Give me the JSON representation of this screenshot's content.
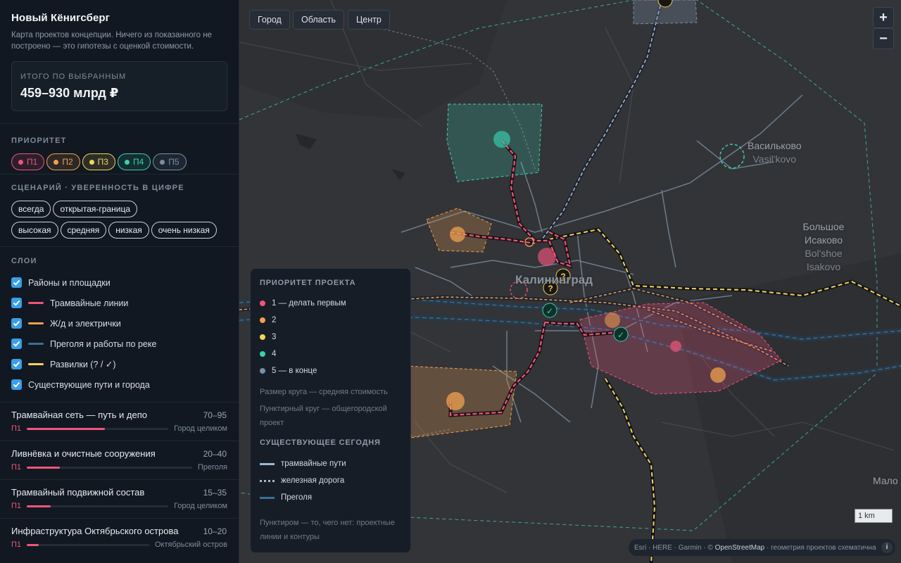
{
  "app": {
    "title": "Новый Кёнигсберг",
    "description": "Карта проектов концепции. Ничего из показанного не построено — это гипотезы с оценкой стоимости."
  },
  "total": {
    "label": "ИТОГО ПО ВЫБРАННЫМ",
    "value": "459–930 млрд ₽"
  },
  "priority": {
    "title": "ПРИОРИТЕТ",
    "items": [
      {
        "label": "П1",
        "color": "#f0557a"
      },
      {
        "label": "П2",
        "color": "#f0a050"
      },
      {
        "label": "П3",
        "color": "#f3d35a"
      },
      {
        "label": "П4",
        "color": "#39d0b0"
      },
      {
        "label": "П5",
        "color": "#7a8ea6"
      }
    ]
  },
  "scenario": {
    "title": "СЦЕНАРИЙ · УВЕРЕННОСТЬ В ЦИФРЕ",
    "chips": [
      "всегда",
      "открытая-граница",
      "высокая",
      "средняя",
      "низкая",
      "очень низкая"
    ]
  },
  "layers": {
    "title": "СЛОИ",
    "items": [
      {
        "label": "Районы и площадки",
        "swatch": ""
      },
      {
        "label": "Трамвайные линии",
        "swatch": "#f0557a"
      },
      {
        "label": "Ж/д и электрички",
        "swatch": "#f0a050"
      },
      {
        "label": "Преголя и работы по реке",
        "swatch": "#3a6f96"
      },
      {
        "label": "Развилки (? / ✓)",
        "swatch": "#f3d35a"
      },
      {
        "label": "Существующие пути и города",
        "swatch": ""
      }
    ]
  },
  "projects": [
    {
      "name": "Трамвайная сеть — путь и депо",
      "cost": "70–95",
      "priority": "П1",
      "scope": "Город целиком",
      "level": 0.55
    },
    {
      "name": "Ливнёвка и очистные сооружения",
      "cost": "20–40",
      "priority": "П1",
      "scope": "Преголя",
      "level": 0.2
    },
    {
      "name": "Трамвайный подвижной состав",
      "cost": "15–35",
      "priority": "П1",
      "scope": "Город целиком",
      "level": 0.17
    },
    {
      "name": "Инфраструктура Октябрьского острова",
      "cost": "10–20",
      "priority": "П1",
      "scope": "Октябрьский остров",
      "level": 0.1
    }
  ],
  "map": {
    "scope_buttons": [
      "Город",
      "Область",
      "Центр"
    ],
    "zoom_in": "+",
    "zoom_out": "−",
    "labels": {
      "city": "Калининград",
      "vasilkovo": {
        "ru": "Васильково",
        "lat": "Vasil'kovo"
      },
      "isakovo": {
        "ru": "Большое Исаково",
        "lat": "Bol'shoe Isakovo"
      },
      "right_edge": "Мало Лугов Мало"
    },
    "scale": "1 km",
    "attribution": {
      "prefix": "Esri · HERE · Garmin · ©",
      "osm": "OpenStreetMap",
      "suffix": "· геометрия проектов схематична",
      "info": "i"
    }
  },
  "legend": {
    "title": "ПРИОРИТЕТ ПРОЕКТА",
    "items": [
      {
        "label": "1 — делать первым",
        "color": "#f0557a"
      },
      {
        "label": "2",
        "color": "#f0a050"
      },
      {
        "label": "3",
        "color": "#f3d35a"
      },
      {
        "label": "4",
        "color": "#39d0b0"
      },
      {
        "label": "5 — в конце",
        "color": "#7a8ea6"
      }
    ],
    "note_size": "Размер круга — средняя стоимость",
    "note_dashed": "Пунктирный круг — общегородской проект",
    "existing_title": "СУЩЕСТВУЮЩЕЕ СЕГОДНЯ",
    "existing": [
      {
        "label": "трамвайные пути",
        "kind": "tram"
      },
      {
        "label": "железная дорога",
        "kind": "rail"
      },
      {
        "label": "Преголя",
        "kind": "river"
      }
    ],
    "note_footer": "Пунктиром — то, чего нет: проектные линии и контуры"
  }
}
